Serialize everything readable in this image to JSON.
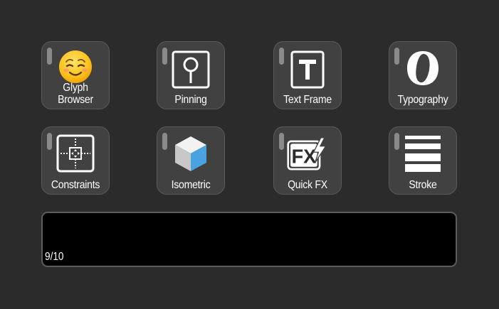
{
  "buttons": [
    {
      "id": "glyph-browser",
      "label_line1": "Glyph",
      "label_line2": "Browser",
      "icon": "smiling-face-icon"
    },
    {
      "id": "pinning",
      "label": "Pinning",
      "icon": "pin-icon"
    },
    {
      "id": "text-frame",
      "label": "Text Frame",
      "icon": "text-frame-icon"
    },
    {
      "id": "typography",
      "label": "Typography",
      "icon": "typography-o-icon"
    },
    {
      "id": "constraints",
      "label": "Constraints",
      "icon": "constraints-icon"
    },
    {
      "id": "isometric",
      "label": "Isometric",
      "icon": "isometric-cube-icon"
    },
    {
      "id": "quick-fx",
      "label": "Quick FX",
      "icon": "quick-fx-icon"
    },
    {
      "id": "stroke",
      "label": "Stroke",
      "icon": "stroke-lines-icon"
    }
  ],
  "display": {
    "page_indicator": "9/10"
  },
  "colors": {
    "background": "#2b2b2b",
    "tile": "#414141",
    "tile_border": "#5a5a5a",
    "led": "#8a8a8a",
    "display": "#000000",
    "emoji_yellow": "#fcc21b",
    "cube_blue": "#4aa3df"
  }
}
